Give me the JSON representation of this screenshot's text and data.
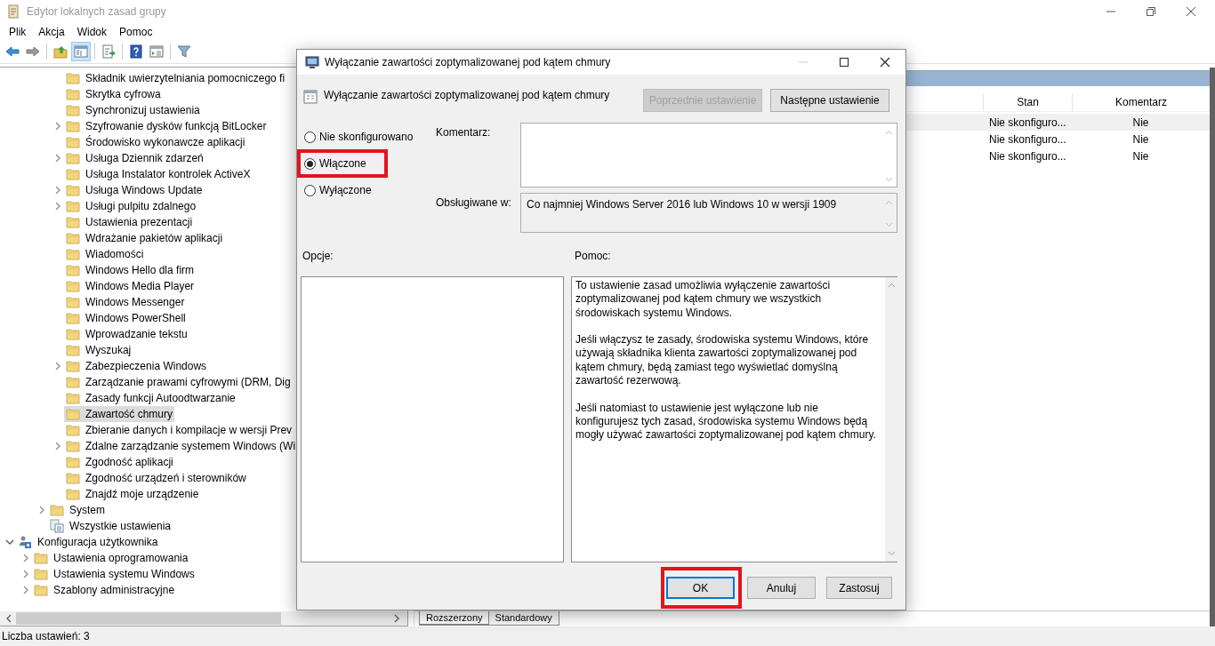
{
  "window": {
    "title": "Edytor lokalnych zasad grupy"
  },
  "menu": [
    "Plik",
    "Akcja",
    "Widok",
    "Pomoc"
  ],
  "toolbar": [
    {
      "kind": "back",
      "pressed": false
    },
    {
      "kind": "forward",
      "pressed": false
    },
    {
      "kind": "separator"
    },
    {
      "kind": "up",
      "pressed": false
    },
    {
      "kind": "tree",
      "pressed": true
    },
    {
      "kind": "separator"
    },
    {
      "kind": "export",
      "pressed": false
    },
    {
      "kind": "separator"
    },
    {
      "kind": "help",
      "pressed": false
    },
    {
      "kind": "view",
      "pressed": false
    },
    {
      "kind": "separator"
    },
    {
      "kind": "filter",
      "pressed": false
    }
  ],
  "tree": [
    {
      "children": [
        {
          "children": [
            {
              "children": [
                {
                  "label": "Składnik uwierzytelniania pomocniczego fi",
                  "kind": "folder",
                  "has_children": false,
                  "selected": false
                },
                {
                  "label": "Skrytka cyfrowa",
                  "kind": "folder",
                  "has_children": false,
                  "selected": false
                },
                {
                  "label": "Synchronizuj ustawienia",
                  "kind": "folder",
                  "has_children": false,
                  "selected": false
                },
                {
                  "label": "Szyfrowanie dysków funkcją BitLocker",
                  "kind": "folder",
                  "has_children": true,
                  "expanded": false,
                  "selected": false
                },
                {
                  "label": "Środowisko wykonawcze aplikacji",
                  "kind": "folder",
                  "has_children": false,
                  "selected": false
                },
                {
                  "label": "Usługa Dziennik zdarzeń",
                  "kind": "folder",
                  "has_children": true,
                  "expanded": false,
                  "selected": false
                },
                {
                  "label": "Usługa Instalator kontrolek ActiveX",
                  "kind": "folder",
                  "has_children": false,
                  "selected": false
                },
                {
                  "label": "Usługa Windows Update",
                  "kind": "folder",
                  "has_children": true,
                  "expanded": false,
                  "selected": false
                },
                {
                  "label": "Usługi pulpitu zdalnego",
                  "kind": "folder",
                  "has_children": true,
                  "expanded": false,
                  "selected": false
                },
                {
                  "label": "Ustawienia prezentacji",
                  "kind": "folder",
                  "has_children": false,
                  "selected": false
                },
                {
                  "label": "Wdrażanie pakietów aplikacji",
                  "kind": "folder",
                  "has_children": false,
                  "selected": false
                },
                {
                  "label": "Wiadomości",
                  "kind": "folder",
                  "has_children": false,
                  "selected": false
                },
                {
                  "label": "Windows Hello dla firm",
                  "kind": "folder",
                  "has_children": false,
                  "selected": false
                },
                {
                  "label": "Windows Media Player",
                  "kind": "folder",
                  "has_children": false,
                  "selected": false
                },
                {
                  "label": "Windows Messenger",
                  "kind": "folder",
                  "has_children": false,
                  "selected": false
                },
                {
                  "label": "Windows PowerShell",
                  "kind": "folder",
                  "has_children": false,
                  "selected": false
                },
                {
                  "label": "Wprowadzanie tekstu",
                  "kind": "folder",
                  "has_children": false,
                  "selected": false
                },
                {
                  "label": "Wyszukaj",
                  "kind": "folder",
                  "has_children": false,
                  "selected": false
                },
                {
                  "label": "Zabezpieczenia Windows",
                  "kind": "folder",
                  "has_children": true,
                  "expanded": false,
                  "selected": false
                },
                {
                  "label": "Zarządzanie prawami cyfrowymi (DRM, Dig",
                  "kind": "folder",
                  "has_children": false,
                  "selected": false
                },
                {
                  "label": "Zasady funkcji Autoodtwarzanie",
                  "kind": "folder",
                  "has_children": false,
                  "selected": false
                },
                {
                  "label": "Zawartość chmury",
                  "kind": "folder",
                  "has_children": false,
                  "selected": true
                },
                {
                  "label": "Zbieranie danych i kompilacje w wersji Prev",
                  "kind": "folder",
                  "has_children": false,
                  "selected": false
                },
                {
                  "label": "Zdalne zarządzanie systemem Windows (Wi",
                  "kind": "folder",
                  "has_children": true,
                  "expanded": false,
                  "selected": false
                },
                {
                  "label": "Zgodność aplikacji",
                  "kind": "folder",
                  "has_children": false,
                  "selected": false
                },
                {
                  "label": "Zgodność urządzeń i sterowników",
                  "kind": "folder",
                  "has_children": false,
                  "selected": false
                },
                {
                  "label": "Znajdź moje urządzenie",
                  "kind": "folder",
                  "has_children": false,
                  "selected": false
                }
              ]
            },
            {
              "label": "System",
              "kind": "folder",
              "has_children": true,
              "expanded": false,
              "selected": false
            },
            {
              "label": "Wszystkie ustawienia",
              "kind": "settings",
              "has_children": false,
              "selected": false
            }
          ]
        }
      ]
    },
    {
      "label": "Konfiguracja użytkownika",
      "kind": "user",
      "has_children": true,
      "expanded": true,
      "selected": false,
      "children": [
        {
          "label": "Ustawienia oprogramowania",
          "kind": "folder",
          "has_children": true,
          "expanded": false,
          "selected": false
        },
        {
          "label": "Ustawienia systemu Windows",
          "kind": "folder",
          "has_children": true,
          "expanded": false,
          "selected": false
        },
        {
          "label": "Szablony administracyjne",
          "kind": "folder",
          "has_children": true,
          "expanded": false,
          "selected": false
        }
      ]
    }
  ],
  "details": {
    "columns": [
      "Stan",
      "Komentarz"
    ],
    "rows": [
      {
        "stan": "Nie skonfiguro...",
        "komentarz": "Nie",
        "selected": true
      },
      {
        "stan": "Nie skonfiguro...",
        "komentarz": "Nie",
        "selected": false
      },
      {
        "stan": "Nie skonfiguro...",
        "komentarz": "Nie",
        "selected": false
      }
    ],
    "view_tabs": [
      {
        "label": "Rozszerzony",
        "selected": true
      },
      {
        "label": "Standardowy",
        "selected": false
      }
    ]
  },
  "status_bar": "Liczba ustawień: 3",
  "dialog": {
    "title": "Wyłączanie zawartości zoptymalizowanej pod kątem chmury",
    "setting_title": "Wyłączanie zawartości zoptymalizowanej pod kątem chmury",
    "nav_buttons": [
      {
        "label": "Poprzednie ustawienie",
        "disabled": true
      },
      {
        "label": "Następne ustawienie",
        "disabled": false
      }
    ],
    "options": [
      {
        "label": "Nie skonfigurowano",
        "selected": false,
        "highlighted": false
      },
      {
        "label": "Włączone",
        "selected": true,
        "highlighted": true
      },
      {
        "label": "Wyłączone",
        "selected": false,
        "highlighted": false
      }
    ],
    "comment_label": "Komentarz:",
    "supported_label": "Obsługiwane w:",
    "supported_value": "Co najmniej Windows Server 2016 lub Windows 10 w wersji 1909",
    "options_label": "Opcje:",
    "help_label": "Pomoc:",
    "help_text": [
      "To ustawienie zasad umożliwia wyłączenie zawartości zoptymalizowanej pod kątem chmury we wszystkich środowiskach systemu Windows.",
      "Jeśli włączysz te zasady, środowiska systemu Windows, które używają składnika klienta zawartości zoptymalizowanej pod kątem chmury, będą zamiast tego wyświetlać domyślną zawartość rezerwową.",
      "Jeśli natomiast to ustawienie jest wyłączone lub nie konfigurujesz tych zasad, środowiska systemu Windows będą mogły używać zawartości zoptymalizowanej pod kątem chmury."
    ],
    "buttons": [
      {
        "label": "OK",
        "default": true,
        "highlighted": true
      },
      {
        "label": "Anuluj",
        "default": false,
        "highlighted": false
      },
      {
        "label": "Zastosuj",
        "default": false,
        "highlighted": false
      }
    ]
  }
}
